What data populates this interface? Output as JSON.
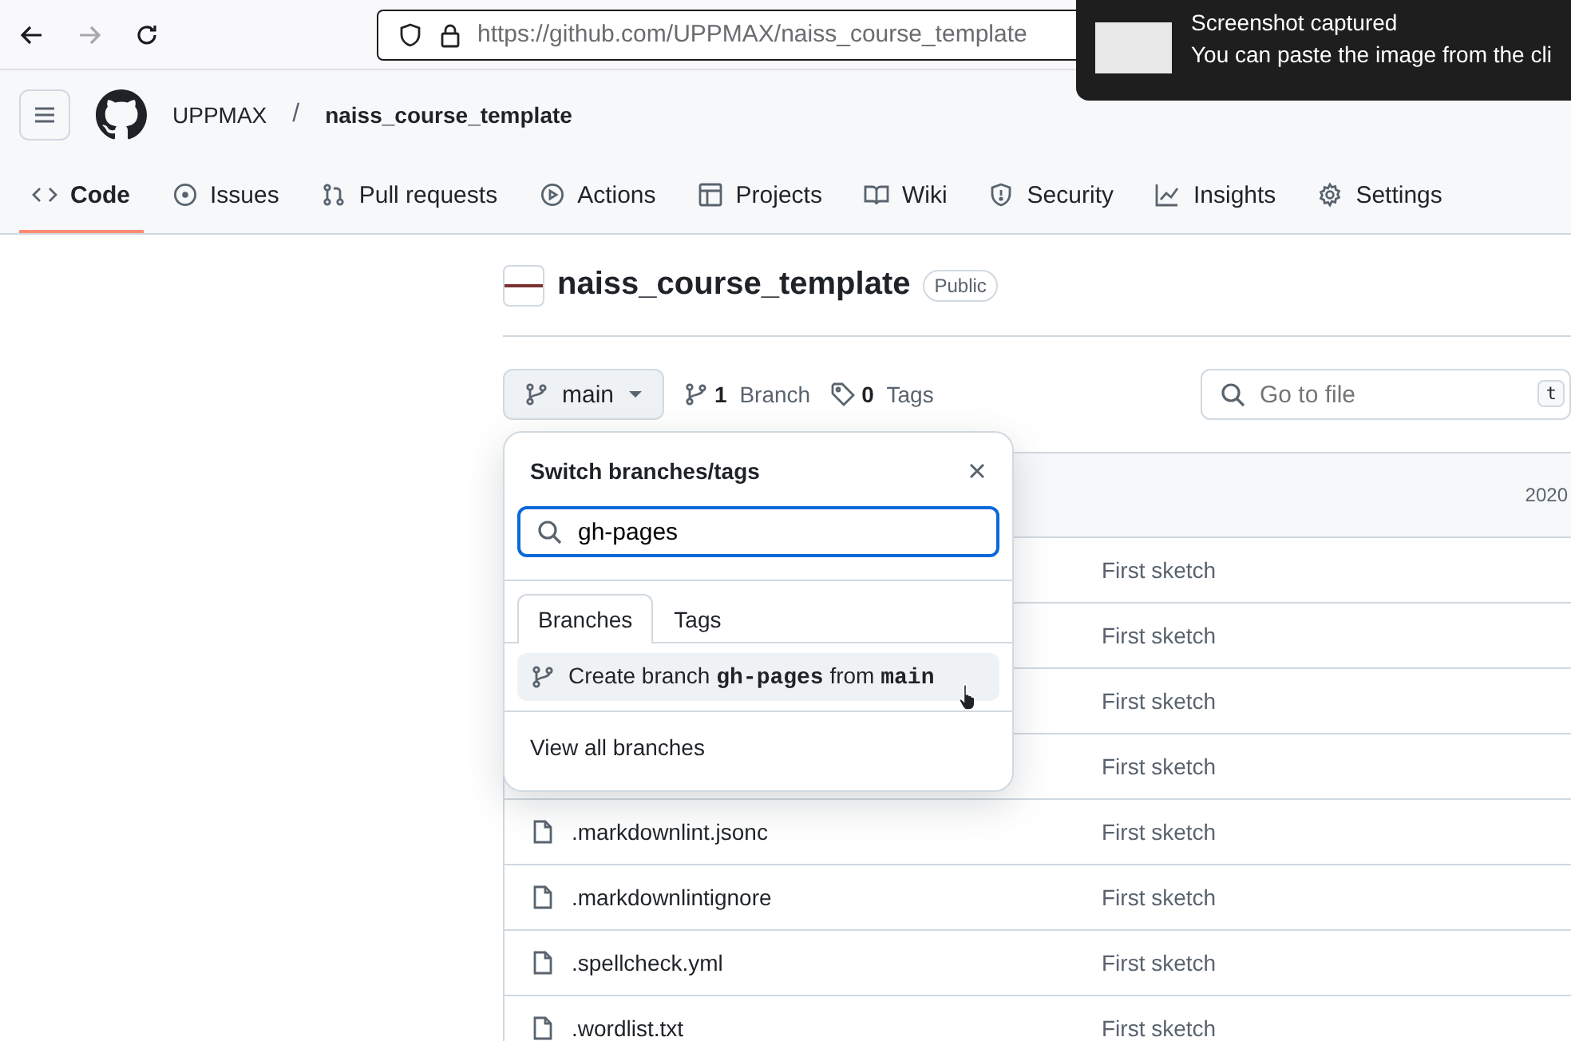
{
  "browser": {
    "nav": [
      {
        "kind": "back",
        "disabled": false
      },
      {
        "kind": "forward",
        "disabled": true
      },
      {
        "kind": "reload",
        "disabled": false
      }
    ],
    "url_host": "https://github.com",
    "url_path": "/UPPMAX/naiss_course_template"
  },
  "toast": {
    "title": "Screenshot captured",
    "message": "You can paste the image from the cli"
  },
  "repo_header": {
    "owner": "UPPMAX",
    "separator": "/",
    "name": "naiss_course_template"
  },
  "tabs": [
    {
      "kind": "code",
      "label": "Code",
      "selected": true
    },
    {
      "kind": "issue",
      "label": "Issues",
      "selected": false
    },
    {
      "kind": "pr",
      "label": "Pull requests",
      "selected": false
    },
    {
      "kind": "play",
      "label": "Actions",
      "selected": false
    },
    {
      "kind": "table",
      "label": "Projects",
      "selected": false
    },
    {
      "kind": "book",
      "label": "Wiki",
      "selected": false
    },
    {
      "kind": "shield",
      "label": "Security",
      "selected": false
    },
    {
      "kind": "graph",
      "label": "Insights",
      "selected": false
    },
    {
      "kind": "gear",
      "label": "Settings",
      "selected": false
    }
  ],
  "repo_title": {
    "name": "naiss_course_template",
    "visibility": "Public"
  },
  "toolbar": {
    "branch": "main",
    "branch_count": "1",
    "branch_label": "Branch",
    "tag_count": "0",
    "tag_label": "Tags",
    "go_to_file": {
      "placeholder": "Go to file",
      "shortcut": "t"
    }
  },
  "table": {
    "header_date": "2020",
    "rows": [
      {
        "name": "",
        "message": "First sketch"
      },
      {
        "name": "",
        "message": "First sketch"
      },
      {
        "name": "",
        "message": "First sketch"
      },
      {
        "name": "",
        "message": "First sketch"
      },
      {
        "name": ".markdownlint.jsonc",
        "message": "First sketch"
      },
      {
        "name": ".markdownlintignore",
        "message": "First sketch"
      },
      {
        "name": ".spellcheck.yml",
        "message": "First sketch"
      },
      {
        "name": ".wordlist.txt",
        "message": "First sketch"
      }
    ]
  },
  "branch_menu": {
    "title": "Switch branches/tags",
    "search": {
      "value": "gh-pages"
    },
    "tabs": [
      {
        "label": "Branches",
        "selected": true
      },
      {
        "label": "Tags",
        "selected": false
      }
    ],
    "create_item": "Create branch **gh-pages** from **main**",
    "footer_link": "View all branches"
  }
}
